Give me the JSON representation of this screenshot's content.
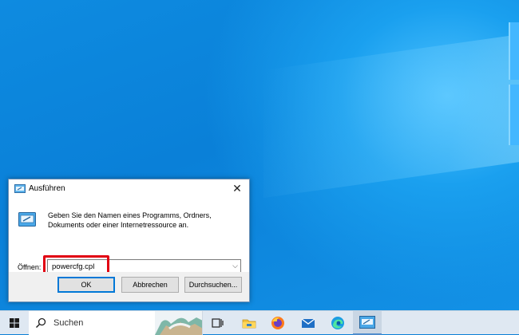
{
  "dialog": {
    "title": "Ausführen",
    "description": "Geben Sie den Namen eines Programms, Ordners, Dokuments oder einer Internetressource an.",
    "open_label": "Öffnen:",
    "command_value": "powercfg.cpl",
    "ok_label": "OK",
    "cancel_label": "Abbrechen",
    "browse_label": "Durchsuchen..."
  },
  "taskbar": {
    "search_placeholder": "Suchen",
    "apps": [
      "task-view",
      "file-explorer",
      "firefox",
      "mail",
      "edge",
      "run"
    ]
  },
  "colors": {
    "highlight": "#e10012",
    "accent": "#0078d7",
    "desktop": "#0a7fd6"
  }
}
